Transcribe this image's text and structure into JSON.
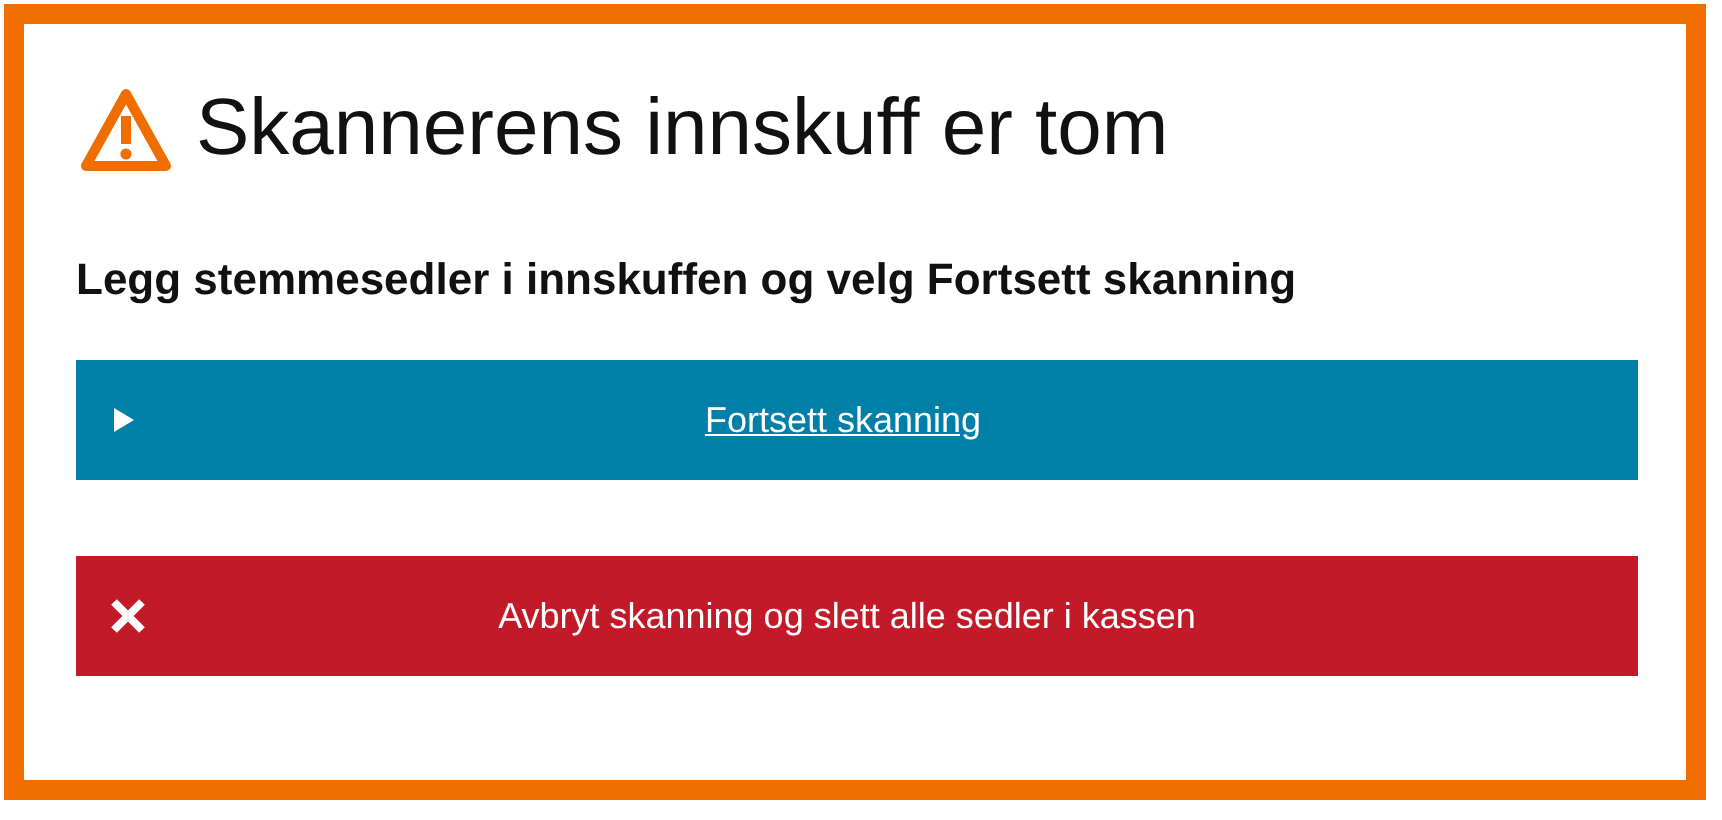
{
  "dialog": {
    "title": "Skannerens innskuff er tom",
    "instruction": "Legg stemmesedler i innskuffen og velg Fortsett skanning",
    "buttons": [
      {
        "kind": "continue",
        "label": "Fortsett skanning",
        "focused": true
      },
      {
        "kind": "cancel",
        "label": "Avbryt skanning og slett alle sedler i kassen",
        "focused": false
      }
    ]
  }
}
